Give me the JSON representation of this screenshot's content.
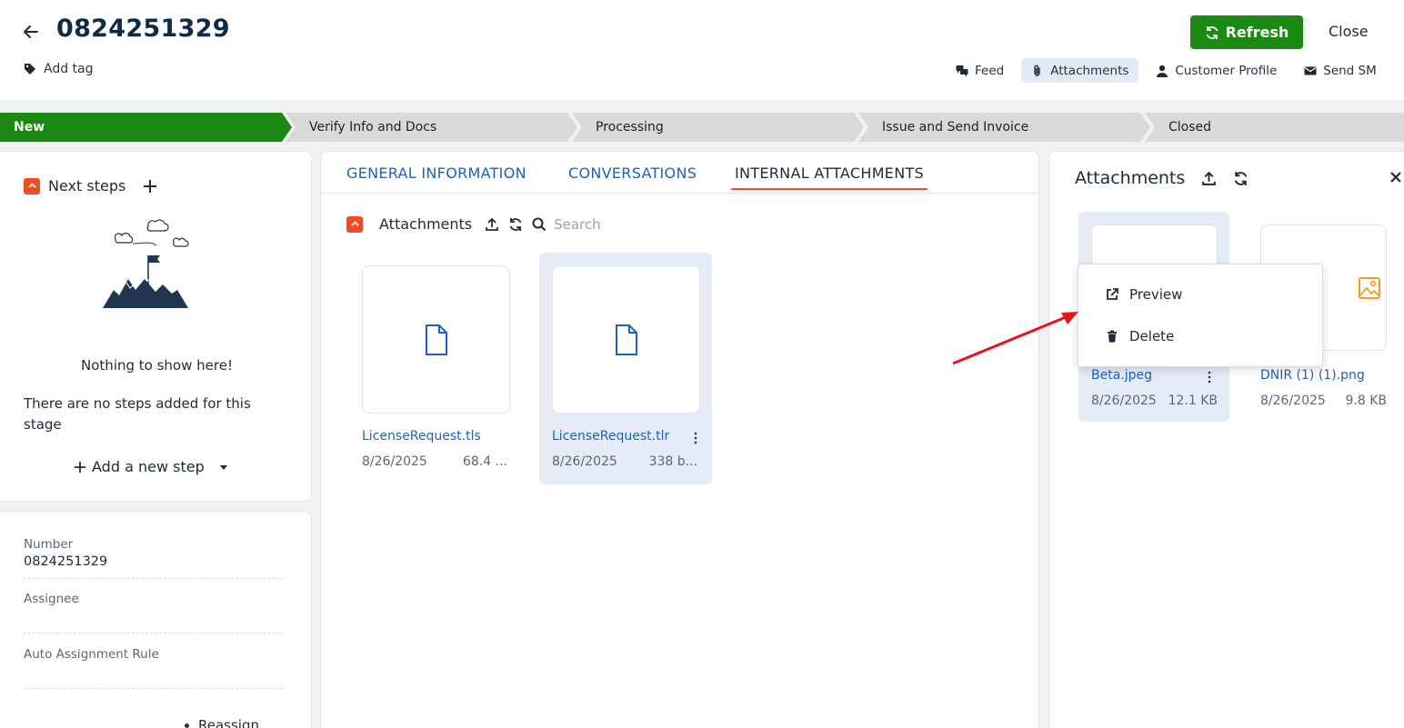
{
  "header": {
    "title": "0824251329",
    "add_tag_label": "Add tag",
    "refresh_label": "Refresh",
    "close_label": "Close",
    "nav": [
      {
        "label": "Feed",
        "icon": "comments-icon"
      },
      {
        "label": "Attachments",
        "icon": "paperclip-icon",
        "active": true
      },
      {
        "label": "Customer Profile",
        "icon": "user-icon"
      },
      {
        "label": "Send SM",
        "icon": "envelope-icon"
      }
    ]
  },
  "stages": [
    "New",
    "Verify Info and Docs",
    "Processing",
    "Issue and Send Invoice",
    "Closed"
  ],
  "colors": {
    "accent_green": "#1b8a12",
    "link_blue": "#1c5fc7",
    "orange": "#ef4e23",
    "stage_grey": "#d9d9d9"
  },
  "next_steps": {
    "title": "Next steps",
    "empty_title": "Nothing to show here!",
    "empty_desc": "There are no steps added for this stage",
    "add_step_label": "Add a new step"
  },
  "details": {
    "number_label": "Number",
    "number_value": "0824251329",
    "assignee_label": "Assignee",
    "assignee_value": "",
    "rule_label": "Auto Assignment Rule",
    "rule_value": "",
    "reassign_label": "Reassign"
  },
  "center": {
    "tabs": [
      "GENERAL INFORMATION",
      "CONVERSATIONS",
      "INTERNAL ATTACHMENTS"
    ],
    "attachments_title": "Attachments",
    "search_placeholder": "Search",
    "files": [
      {
        "name": "LicenseRequest.tls",
        "date": "8/26/2025",
        "size": "68.4 ..."
      },
      {
        "name": "LicenseRequest.tlr",
        "date": "8/26/2025",
        "size": "338 b..."
      }
    ]
  },
  "right": {
    "title": "Attachments",
    "files": [
      {
        "name": "Beta.jpeg",
        "date": "8/26/2025",
        "size": "12.1 KB"
      },
      {
        "name": "DNIR (1) (1).png",
        "date": "8/26/2025",
        "size": "9.8 KB"
      }
    ],
    "menu": {
      "preview_label": "Preview",
      "delete_label": "Delete"
    }
  }
}
